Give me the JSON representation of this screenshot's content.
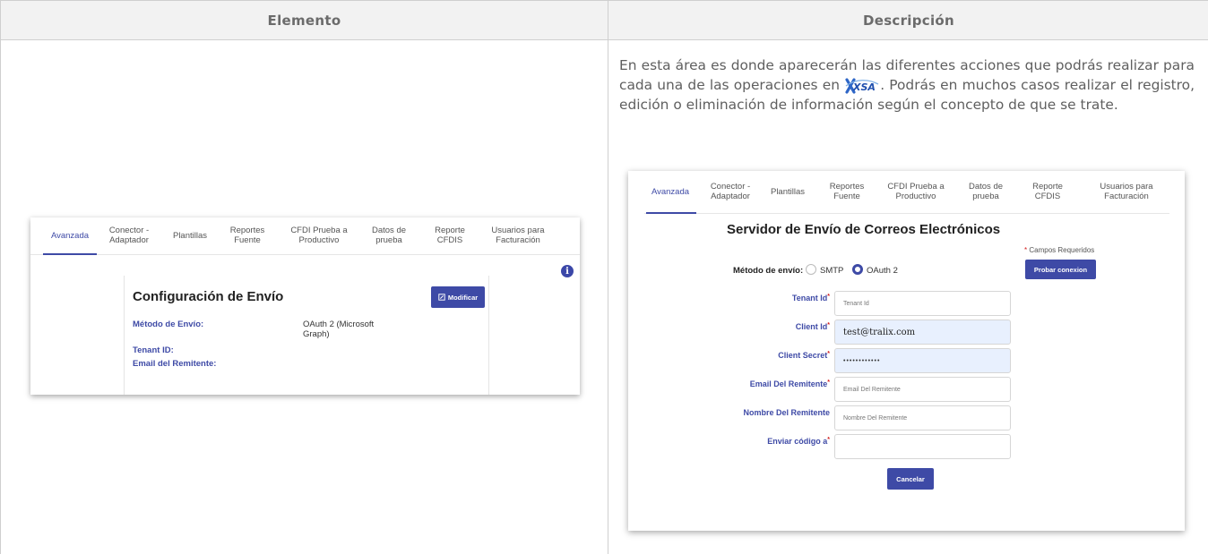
{
  "table": {
    "header_element": "Elemento",
    "header_description": "Descripción"
  },
  "description": {
    "text_before_logo": "En esta área es donde aparecerán las diferentes acciones que podrás realizar para cada una de las operaciones en",
    "logo_text": "XSA",
    "text_after_logo": ". Podrás en muchos casos realizar el registro, edición o eliminación de información según el concepto de que se trate."
  },
  "tabs": [
    {
      "label": "Avanzada",
      "active": true
    },
    {
      "label": "Conector -\nAdaptador"
    },
    {
      "label": "Plantillas"
    },
    {
      "label": "Reportes\nFuente"
    },
    {
      "label": "CFDI Prueba a\nProductivo"
    },
    {
      "label": "Datos de\nprueba"
    },
    {
      "label": "Reporte\nCFDIS"
    },
    {
      "label": "Usuarios para\nFacturación"
    }
  ],
  "config_card": {
    "title": "Configuración de Envío",
    "modify_button": "Modificar",
    "method_label": "Método de Envío:",
    "method_value": "OAuth 2 (Microsoft Graph)",
    "tenant_label": "Tenant ID:",
    "sender_label": "Email del Remitente:",
    "info_icon": "i"
  },
  "server_form": {
    "title": "Servidor de Envío de Correos Electrónicos",
    "required_note": "Campos Requeridos",
    "required_star": "*",
    "test_button": "Probar conexion",
    "method_label": "Método de envío:",
    "radio_options": [
      {
        "label": "SMTP",
        "selected": false
      },
      {
        "label": "OAuth 2",
        "selected": true
      }
    ],
    "fields": [
      {
        "label": "Tenant Id",
        "required": true,
        "placeholder": "Tenant Id",
        "value": ""
      },
      {
        "label": "Client Id",
        "required": true,
        "placeholder": "",
        "value": "test@tralix.com"
      },
      {
        "label": "Client Secret",
        "required": true,
        "placeholder": "",
        "value": "••••••••••••"
      },
      {
        "label": "Email Del Remitente",
        "required": true,
        "placeholder": "Email Del Remitente",
        "value": ""
      },
      {
        "label": "Nombre Del Remitente",
        "required": false,
        "placeholder": "Nombre Del Remitente",
        "value": ""
      },
      {
        "label": "Enviar código a",
        "required": true,
        "placeholder": "",
        "value": ""
      }
    ],
    "cancel_button": "Cancelar"
  },
  "colors": {
    "accent": "#3e4aa6",
    "required": "#d21c1c",
    "autofill": "#e8f0fe",
    "header_bg": "#f2f2f2"
  }
}
